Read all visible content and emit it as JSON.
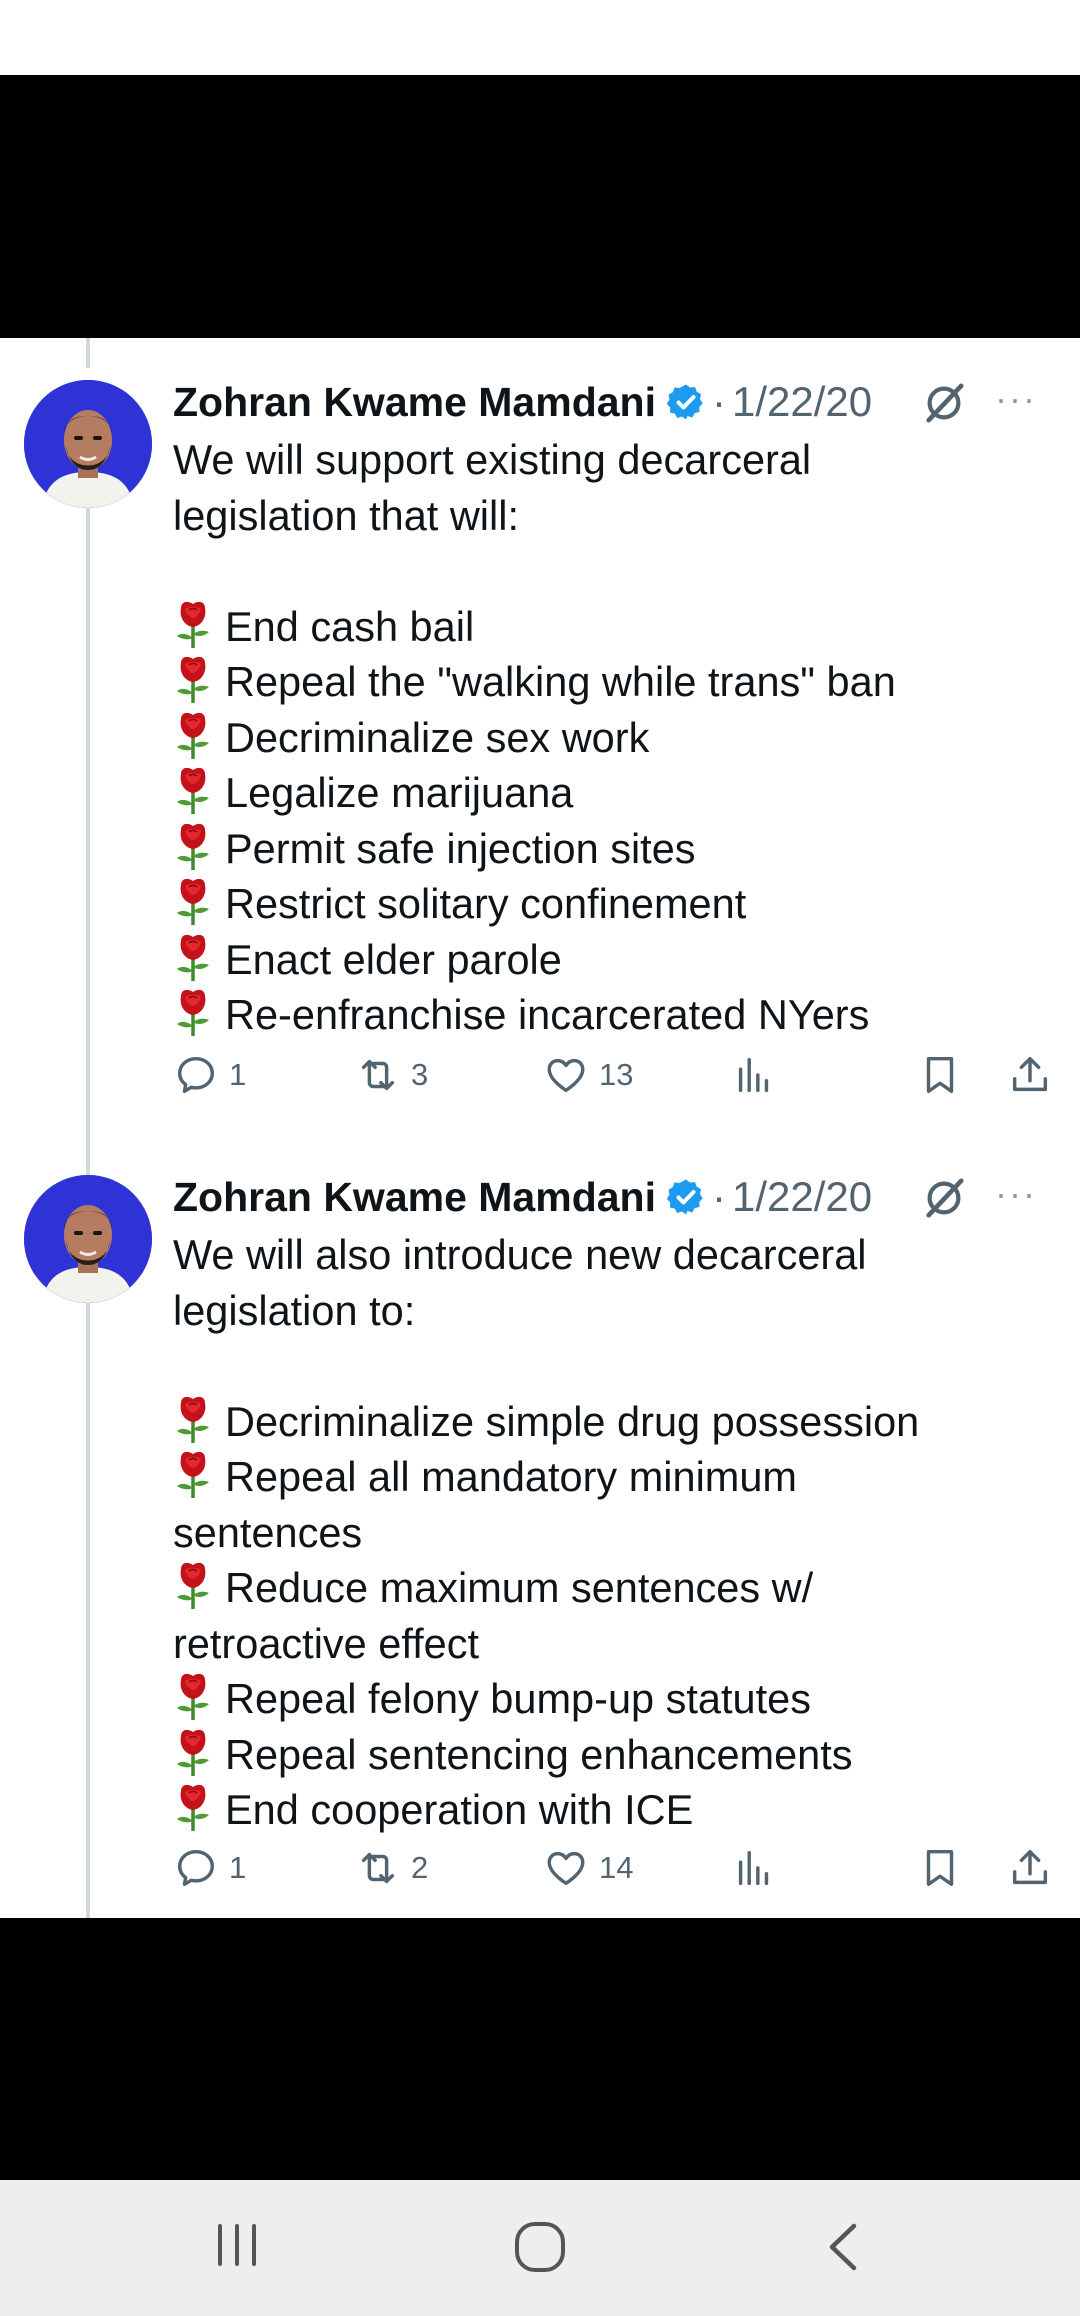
{
  "tweets": [
    {
      "author": "Zohran Kwame Mamdani",
      "separator": "·",
      "date": "1/22/20",
      "more": "···",
      "lines": [
        "We will support existing decarceral",
        "legislation that will:",
        "",
        "End cash bail",
        "Repeal the \"walking while trans\" ban",
        "Decriminalize sex work",
        "Legalize marijuana",
        "Permit safe injection sites",
        "Restrict solitary confinement",
        "Enact elder parole",
        "Re-enfranchise incarcerated NYers"
      ],
      "replies": "1",
      "retweets": "3",
      "likes": "13"
    },
    {
      "author": "Zohran Kwame Mamdani",
      "separator": "·",
      "date": "1/22/20",
      "more": "···",
      "lines": [
        "We will also introduce new decarceral",
        "legislation to:",
        "",
        "Decriminalize simple drug possession",
        "Repeal all mandatory minimum",
        "sentences",
        "Reduce maximum sentences w/",
        "retroactive effect",
        "Repeal felony bump-up statutes",
        "Repeal sentencing enhancements",
        "End cooperation with ICE"
      ],
      "replies": "1",
      "retweets": "2",
      "likes": "14"
    }
  ],
  "icons": {
    "rose": "rose-emoji",
    "verified": "verified-badge-icon",
    "grok": "grok-icon",
    "reply": "reply-icon",
    "retweet": "retweet-icon",
    "like": "heart-icon",
    "views": "views-icon",
    "bookmark": "bookmark-icon",
    "share": "share-icon"
  },
  "colors": {
    "verified": "#1d9bf0",
    "secondary_text": "#536471",
    "thread_line": "#cfd9de",
    "avatar_bg": "#2f33d6",
    "navbar_bg": "#eeeef0"
  },
  "navbar": {
    "recents": "recent-apps-icon",
    "home": "home-icon",
    "back": "back-icon"
  }
}
